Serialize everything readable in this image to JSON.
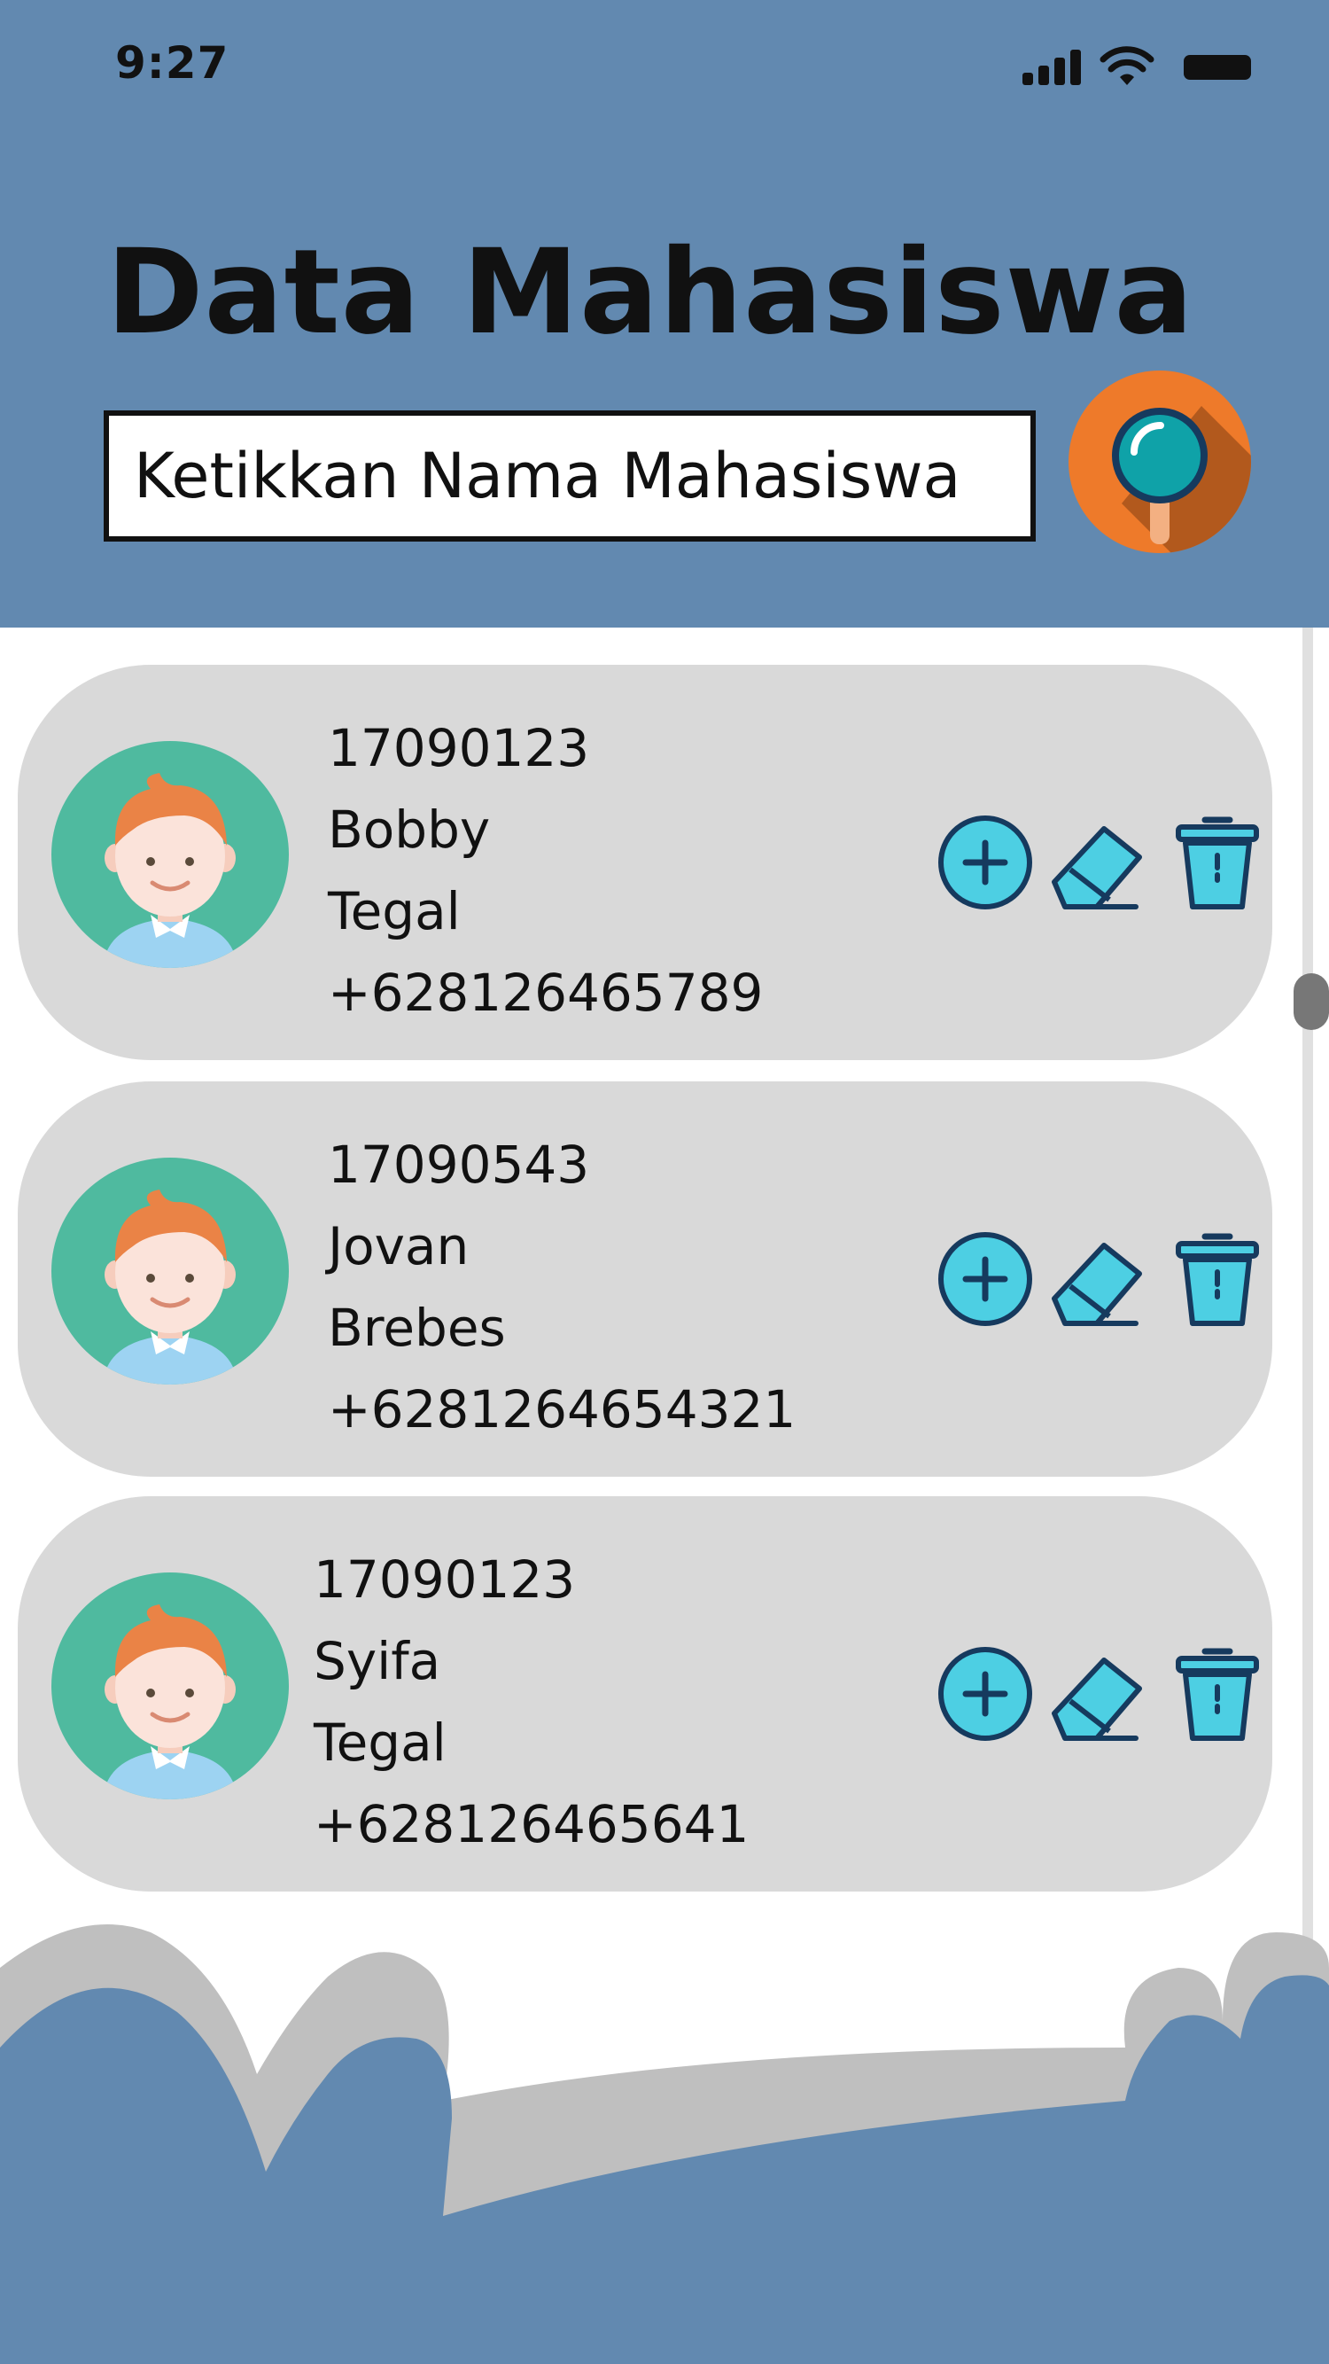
{
  "status_bar": {
    "time": "9:27",
    "icons": [
      "signal-icon",
      "wifi-icon",
      "battery-icon"
    ]
  },
  "header": {
    "title": "Data Mahasiswa",
    "search": {
      "placeholder": "Ketikkan Nama Mahasiswa",
      "value": ""
    },
    "search_button_icon": "magnifier-icon"
  },
  "students": [
    {
      "nim": "17090123",
      "name": "Bobby",
      "city": "Tegal",
      "phone": "+628126465789"
    },
    {
      "nim": "17090543",
      "name": "Jovan",
      "city": "Brebes",
      "phone": "+6281264654321"
    },
    {
      "nim": "17090123",
      "name": "Syifa",
      "city": "Tegal",
      "phone": "+628126465641"
    }
  ],
  "row_actions": [
    "add-icon",
    "edit-eraser-icon",
    "delete-trash-icon"
  ],
  "colors": {
    "header_bg": "#6289b0",
    "card_bg": "#d9d9d9",
    "avatar_bg": "#4fba9f",
    "search_button_bg": "#ee7a2a",
    "action_icon": "#4dcfe3",
    "action_outline": "#163a5e",
    "footer_blue": "#6289b0",
    "footer_gray": "#bfbfbf"
  }
}
